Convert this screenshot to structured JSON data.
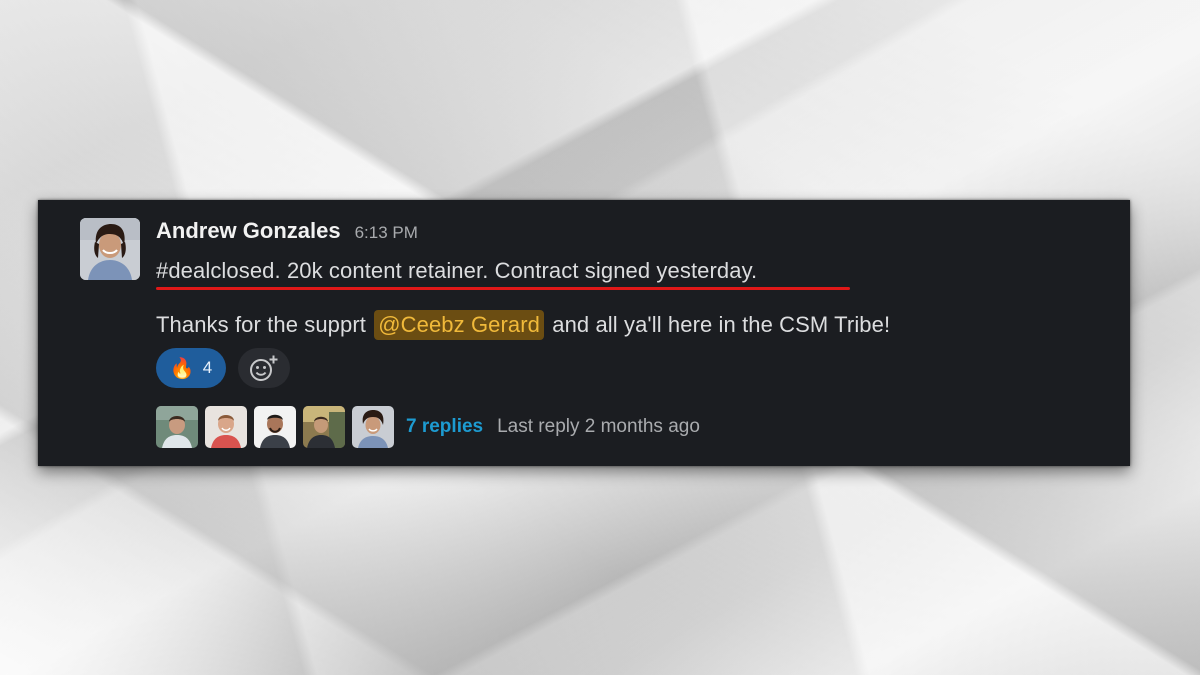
{
  "message": {
    "author": "Andrew Gonzales",
    "timestamp": "6:13 PM",
    "line1": "#dealclosed. 20k content retainer. Contract signed yesterday.",
    "line2_before": "Thanks for the supprt",
    "mention": "@Ceebz Gerard",
    "line2_after": "and all ya'll here in the CSM Tribe!"
  },
  "reactions": [
    {
      "emoji": "🔥",
      "count": "4",
      "icon": "fire-icon"
    }
  ],
  "add_reaction_icon": "add-reaction-icon",
  "thread": {
    "avatars": [
      "participant-avatar-1",
      "participant-avatar-2",
      "participant-avatar-3",
      "participant-avatar-4",
      "participant-avatar-5"
    ],
    "replies": "7 replies",
    "last_reply": "Last reply 2 months ago"
  },
  "colors": {
    "card_bg": "#1b1d21",
    "mention_bg": "#6b4d12",
    "mention_text": "#f0b93a",
    "reaction_bg": "#1f5d9c",
    "link": "#1d9bd1",
    "highlight_underline": "#e01818"
  }
}
